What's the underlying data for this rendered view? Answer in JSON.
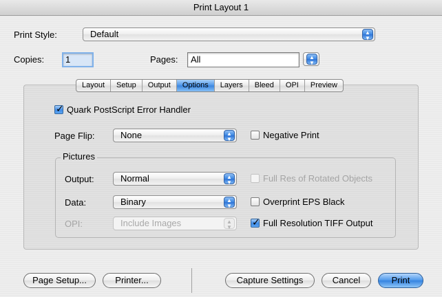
{
  "window": {
    "title": "Print Layout 1"
  },
  "print_style": {
    "label": "Print Style:",
    "value": "Default"
  },
  "copies": {
    "label": "Copies:",
    "value": "1"
  },
  "pages": {
    "label": "Pages:",
    "value": "All"
  },
  "tabs": [
    {
      "label": "Layout",
      "active": false
    },
    {
      "label": "Setup",
      "active": false
    },
    {
      "label": "Output",
      "active": false
    },
    {
      "label": "Options",
      "active": true
    },
    {
      "label": "Layers",
      "active": false
    },
    {
      "label": "Bleed",
      "active": false
    },
    {
      "label": "OPI",
      "active": false
    },
    {
      "label": "Preview",
      "active": false
    }
  ],
  "options": {
    "error_handler": {
      "label": "Quark PostScript Error Handler",
      "checked": true
    },
    "page_flip": {
      "label": "Page Flip:",
      "value": "None"
    },
    "negative_print": {
      "label": "Negative Print",
      "checked": false
    },
    "pictures": {
      "title": "Pictures",
      "output": {
        "label": "Output:",
        "value": "Normal"
      },
      "data": {
        "label": "Data:",
        "value": "Binary"
      },
      "opi": {
        "label": "OPI:",
        "value": "Include Images",
        "enabled": false
      },
      "full_res_rotated": {
        "label": "Full Res of Rotated Objects",
        "checked": false,
        "enabled": false
      },
      "overprint_eps": {
        "label": "Overprint EPS Black",
        "checked": false
      },
      "full_res_tiff": {
        "label": "Full Resolution TIFF Output",
        "checked": true
      }
    }
  },
  "buttons": {
    "page_setup": "Page Setup...",
    "printer": "Printer...",
    "capture_settings": "Capture Settings",
    "cancel": "Cancel",
    "print": "Print"
  },
  "colors": {
    "accent": "#3a84de"
  }
}
